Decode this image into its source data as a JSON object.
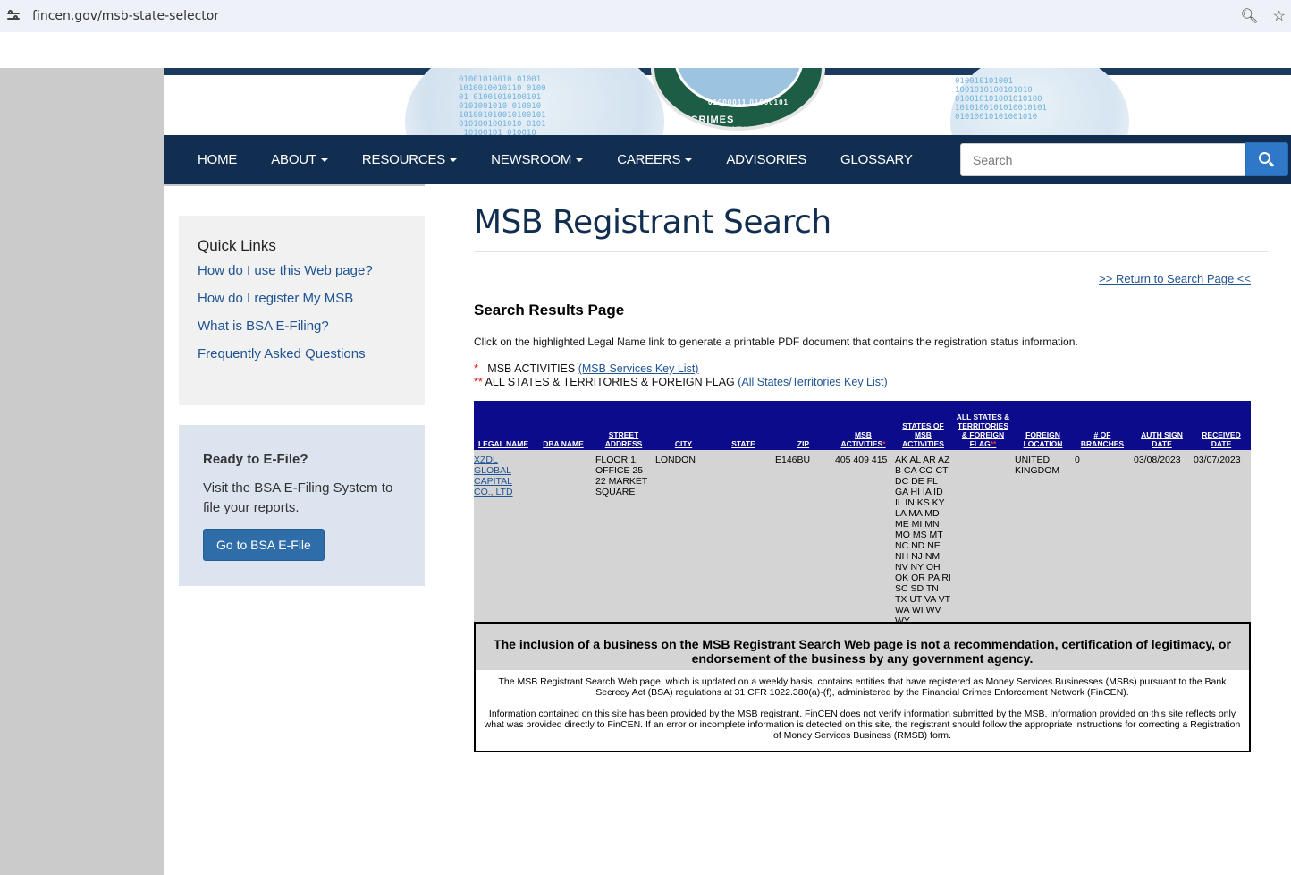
{
  "browser": {
    "url": "fincen.gov/msb-state-selector"
  },
  "banner": {
    "seal_text": "AL CRIMES ENFORCEMENT",
    "seal_binary": "01000011 01000101",
    "binary_left": "01001010010 01001\n1010010010110 0100\n01 01001010100101\n0101001010 010010\n101001010010100101\n0101001001010 0101\n 10100101 010010",
    "binary_right": "010010101001\n1001010100101010\n010010101001010100\n1010100101010010101\n01010010101001010"
  },
  "nav": {
    "items": [
      {
        "label": "HOME",
        "dropdown": false
      },
      {
        "label": "ABOUT",
        "dropdown": true
      },
      {
        "label": "RESOURCES",
        "dropdown": true
      },
      {
        "label": "NEWSROOM",
        "dropdown": true
      },
      {
        "label": "CAREERS",
        "dropdown": true
      },
      {
        "label": "ADVISORIES",
        "dropdown": false
      },
      {
        "label": "GLOSSARY",
        "dropdown": false
      }
    ],
    "search_placeholder": "Search"
  },
  "sidebar": {
    "quick_links_title": "Quick Links",
    "links": [
      "How do I use this Web page?",
      "How do I register My MSB",
      "What is BSA E-Filing?",
      "Frequently Asked Questions"
    ],
    "efile_title": "Ready to E-File?",
    "efile_text": "Visit the BSA E-Filing System to file your reports.",
    "efile_button": "Go to BSA E-File"
  },
  "main": {
    "title": "MSB Registrant Search",
    "return_link": ">> Return to Search Page <<",
    "results_heading": "Search Results Page",
    "instructions": "Click on the highlighted Legal Name link to generate a printable PDF document that contains the registration status information.",
    "key1_marker": "*",
    "key1_text": "MSB ACTIVITIES",
    "key1_link": "(MSB Services Key List)",
    "key2_marker": "**",
    "key2_text": "ALL STATES & TERRITORIES & FOREIGN FLAG",
    "key2_link": "(All States/Territories Key List)"
  },
  "table": {
    "headers": [
      "LEGAL NAME",
      "DBA NAME",
      "STREET ADDRESS",
      "CITY",
      "STATE",
      "ZIP",
      "MSB ACTIVITIES",
      "STATES OF MSB ACTIVITIES",
      "ALL STATES & TERRITORIES & FOREIGN FLAG",
      "FOREIGN LOCATION",
      "# OF BRANCHES",
      "AUTH SIGN DATE",
      "RECEIVED DATE"
    ],
    "header_marks": {
      "msb_activities": "*",
      "all_states": "**"
    },
    "row": {
      "legal_name": "XZDL GLOBAL CAPITAL CO., LTD",
      "dba_name": "",
      "street": "FLOOR 1, OFFICE 25 22 MARKET SQUARE",
      "city": "LONDON",
      "state": "",
      "zip": "E146BU",
      "msb_activities": "405 409 415",
      "states": "AK AL AR AZ B CA CO CT DC DE FL GA HI IA ID IL IN KS KY LA MA MD ME MI MN MO MS MT NC ND NE NH NJ NM NV NY OH OK OR PA RI SC SD TN TX UT VA VT WA WI WV WY",
      "all_states_flag": "",
      "foreign_location": "UNITED KINGDOM",
      "branches": "0",
      "auth_sign_date": "03/08/2023",
      "received_date": "03/07/2023"
    }
  },
  "disclaimer": {
    "lead": "The inclusion of a business on the MSB Registrant Search Web page is not a recommendation, certification of legitimacy, or endorsement of the business by any government agency.",
    "para1": "The MSB Registrant Search Web page, which is updated on a weekly basis, contains entities that have registered as Money Services Businesses (MSBs) pursuant to the Bank Secrecy Act (BSA) regulations at 31 CFR 1022.380(a)-(f), administered by the Financial Crimes Enforcement Network (FinCEN).",
    "para2": "Information contained on this site has been provided by the MSB registrant. FinCEN does not verify information submitted by the MSB. Information provided on this site reflects only what was provided directly to FinCEN. If an error or incomplete information is detected on this site, the registrant should follow the appropriate instructions for correcting a Registration of Money Services Business (RMSB) form."
  },
  "colors": {
    "nav_bg": "#112e51",
    "link": "#205493",
    "table_header": "#0b0b8c",
    "table_row": "#d4d4d4",
    "accent_button": "#2e78c7"
  }
}
